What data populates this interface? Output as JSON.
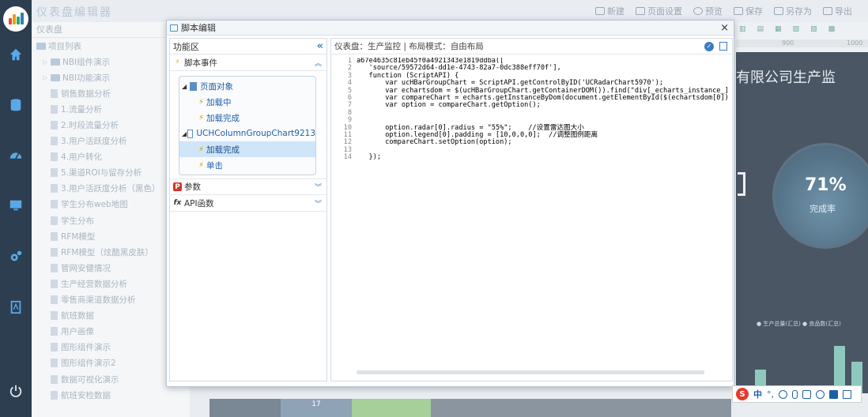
{
  "app": {
    "title": "仪表盘编辑器",
    "toolbar": [
      {
        "label": "新建"
      },
      {
        "label": "页面设置"
      },
      {
        "label": "预览"
      },
      {
        "label": "保存"
      },
      {
        "label": "另存为"
      },
      {
        "label": "导出"
      }
    ]
  },
  "project_panel": {
    "header": "仪表盘",
    "root": "项目列表",
    "items": [
      "NBI组件演示",
      "NBI功能演示",
      "销售数据分析",
      "1.流量分析",
      "2.时段流量分析",
      "3.用户活跃度分析",
      "4.用户转化",
      "5.渠道ROI与留存分析",
      "3.用户活跃度分析（黑色）",
      "学生分布web地图",
      "学生分布",
      "RFM模型",
      "RFM模型（炫酷黑皮肤）",
      "管网安健情况",
      "生产经营数据分析",
      "零售商渠道数据分析",
      "航班数据",
      "用户画像",
      "图形组件演示",
      "图形组件演示2",
      "数据可视化演示",
      "航班安检数据"
    ]
  },
  "dashboard_preview": {
    "ruler_labels": [
      "900",
      "1000"
    ],
    "title": "有限公司生产监",
    "gauge_value": "71%",
    "gauge_label": "完成率",
    "legend": "● 生产总量(汇总)  ● 良品数(汇总)",
    "bottom_number": "17"
  },
  "dialog": {
    "title": "脚本编辑",
    "close_glyph": "×",
    "func_panel": {
      "header": "功能区",
      "sections": {
        "events": "脚本事件",
        "params": "参数",
        "api": "API函数"
      },
      "tree": [
        {
          "label": "页面对象",
          "children": [
            "加载中",
            "加载完成"
          ]
        },
        {
          "label": "UCHColumnGroupChart9213",
          "children": [
            "加载完成",
            "单击"
          ]
        }
      ]
    },
    "editor": {
      "header": "仪表盘：生产监控 | 布局模式：自由布局",
      "line_numbers": [
        "1",
        "2",
        "3",
        "4",
        "5",
        "6",
        "7",
        "8",
        "9",
        "10",
        "11",
        "12",
        "13",
        "14"
      ],
      "code": [
        "a67e4635c81eb45f0a4921343e1819ddba([",
        "   'source/59572d64-dd1e-4743-82a7-0dc388eff70f'],",
        "   function (ScriptAPI) {",
        "       var ucHBarGroupChart = ScriptAPI.getControlByID('UCRadarChart5970');",
        "       var echartsdom = $(ucHBarGroupChart.getContainerDOM()).find(\"div[_echarts_instance_]\");",
        "       var compareChart = echarts.getInstanceByDom(document.getElementById($(echartsdom[0]).attr(\"",
        "       var option = compareChart.getOption();",
        "",
        "",
        "       option.radar[0].radius = \"55%\";    //设置雷达图大小",
        "       option.legend[0].padding = [10,0,0,0];  //调整图例距离",
        "       compareChart.setOption(option);",
        "",
        "   });"
      ]
    }
  },
  "ime": {
    "logo": "S",
    "mode": "中",
    "punct": "°,"
  }
}
